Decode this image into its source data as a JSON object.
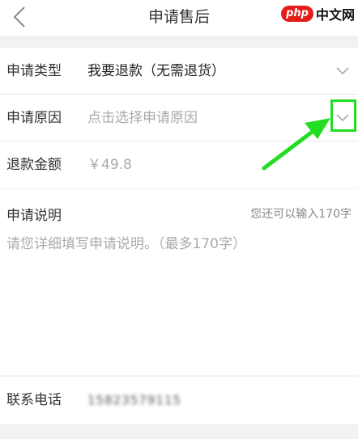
{
  "nav": {
    "title": "申请售后",
    "watermark_logo": "php",
    "watermark_text": "中文网"
  },
  "form": {
    "type": {
      "label": "申请类型",
      "value": "我要退款（无需退货）"
    },
    "reason": {
      "label": "申请原因",
      "placeholder": "点击选择申请原因"
    },
    "amount": {
      "label": "退款金额",
      "value": "￥49.8"
    },
    "description": {
      "label": "申请说明",
      "counter": "您还可以输入170字",
      "placeholder": "请您详细填写申请说明。（最多170字）"
    },
    "phone": {
      "label": "联系电话",
      "value": "15823579115"
    }
  },
  "colors": {
    "annotation": "#22dd22"
  }
}
